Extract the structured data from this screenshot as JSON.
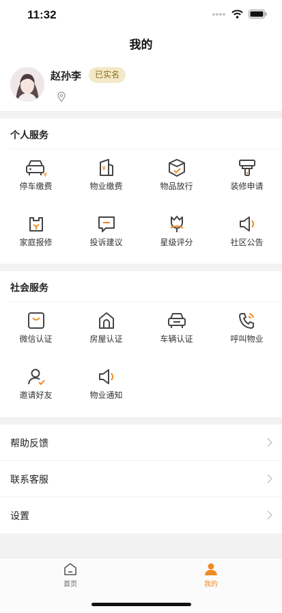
{
  "status": {
    "time": "11:32"
  },
  "nav": {
    "title": "我的"
  },
  "profile": {
    "name": "赵孙李",
    "badge": "已实名"
  },
  "personal": {
    "title": "个人服务",
    "items": [
      {
        "label": "停车缴费",
        "icon": "car-fee-icon"
      },
      {
        "label": "物业缴费",
        "icon": "property-fee-icon"
      },
      {
        "label": "物品放行",
        "icon": "package-release-icon"
      },
      {
        "label": "装修申请",
        "icon": "paint-brush-icon"
      },
      {
        "label": "家庭报修",
        "icon": "home-repair-icon"
      },
      {
        "label": "投诉建议",
        "icon": "complaint-message-icon"
      },
      {
        "label": "星级评分",
        "icon": "flower-rating-icon"
      },
      {
        "label": "社区公告",
        "icon": "megaphone-icon"
      }
    ]
  },
  "social": {
    "title": "社会服务",
    "items": [
      {
        "label": "微信认证",
        "icon": "wechat-bag-icon"
      },
      {
        "label": "房屋认证",
        "icon": "house-icon"
      },
      {
        "label": "车辆认证",
        "icon": "car-icon"
      },
      {
        "label": "呼叫物业",
        "icon": "phone-call-icon"
      },
      {
        "label": "邀请好友",
        "icon": "invite-user-icon"
      },
      {
        "label": "物业通知",
        "icon": "notice-megaphone-icon"
      }
    ]
  },
  "list": [
    {
      "label": "帮助反馈"
    },
    {
      "label": "联系客服"
    },
    {
      "label": "设置"
    }
  ],
  "tabbar": {
    "home": {
      "label": "首页"
    },
    "mine": {
      "label": "我的"
    }
  },
  "colors": {
    "accent": "#f08a24",
    "icon": "#444444",
    "badge_bg": "#f3e9c9"
  }
}
